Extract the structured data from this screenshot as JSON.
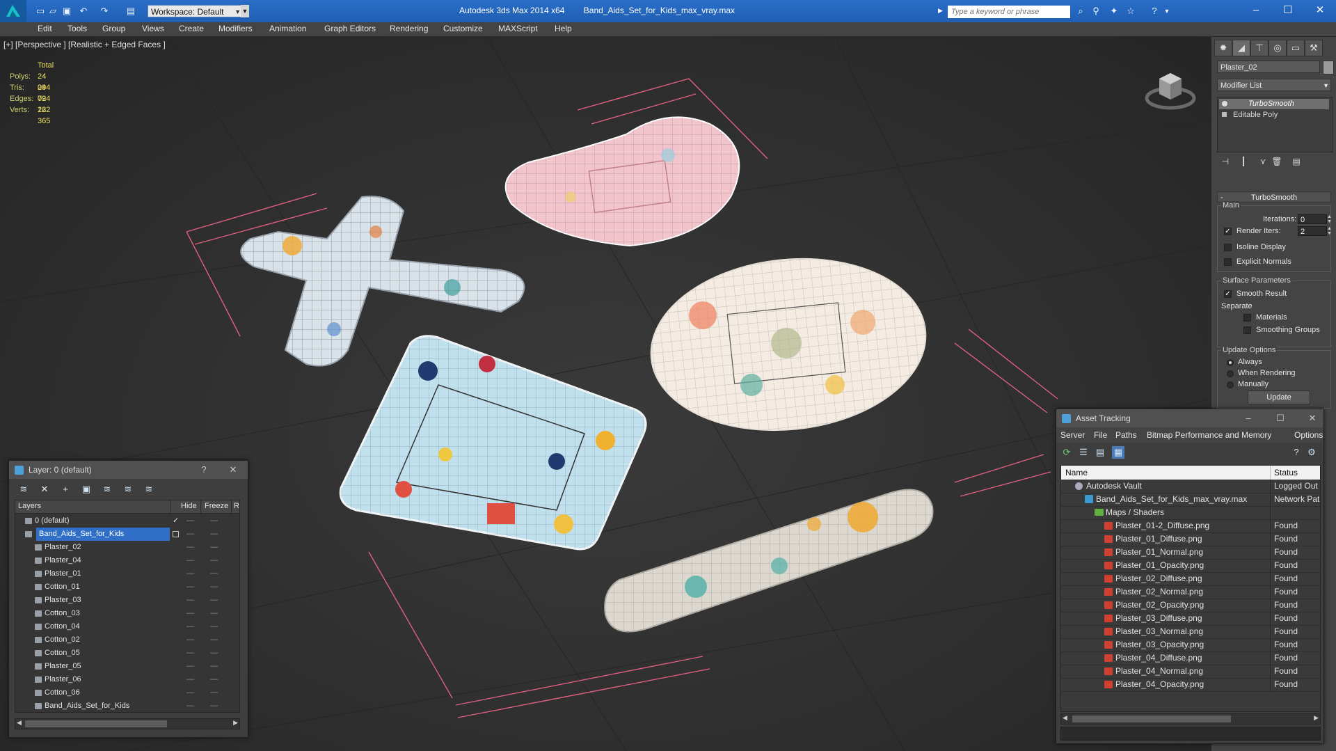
{
  "titlebar": {
    "workspace": "Workspace: Default",
    "app_name": "Autodesk 3ds Max  2014 x64",
    "file_name": "Band_Aids_Set_for_Kids_max_vray.max",
    "search_placeholder": "Type a keyword or phrase"
  },
  "menu": [
    "Edit",
    "Tools",
    "Group",
    "Views",
    "Create",
    "Modifiers",
    "Animation",
    "Graph Editors",
    "Rendering",
    "Customize",
    "MAXScript",
    "Help"
  ],
  "viewport": {
    "label": "[+] [Perspective ] [Realistic + Edged Faces ]",
    "stats": {
      "header": "Total",
      "rows": [
        {
          "key": "Polys:",
          "value": "24 094"
        },
        {
          "key": "Tris:",
          "value": "24 094"
        },
        {
          "key": "Edges:",
          "value": "72 282"
        },
        {
          "key": "Verts:",
          "value": "12 365"
        }
      ]
    }
  },
  "command_panel": {
    "object_name": "Plaster_02",
    "modifier_list": "Modifier List",
    "stack": [
      "TurboSmooth",
      "Editable Poly"
    ],
    "rollout_title": "TurboSmooth",
    "main_group": "Main",
    "iterations_label": "Iterations:",
    "iterations_value": "0",
    "render_iters_label": "Render Iters:",
    "render_iters_value": "2",
    "isoline_display": "Isoline Display",
    "explicit_normals": "Explicit Normals",
    "surface_group": "Surface Parameters",
    "smooth_result": "Smooth Result",
    "separate_label": "Separate",
    "materials": "Materials",
    "smoothing_groups": "Smoothing Groups",
    "update_group": "Update Options",
    "opt_always": "Always",
    "opt_when_rendering": "When Rendering",
    "opt_manually": "Manually",
    "update_button": "Update"
  },
  "layer_dialog": {
    "title": "Layer: 0 (default)",
    "help": "?",
    "columns": [
      "Layers",
      "Hide",
      "Freeze",
      "R"
    ],
    "rows": [
      {
        "name": "0 (default)",
        "level": 0,
        "check": "✓"
      },
      {
        "name": "Band_Aids_Set_for_Kids",
        "level": 0,
        "selected": true
      },
      {
        "name": "Plaster_02",
        "level": 1
      },
      {
        "name": "Plaster_04",
        "level": 1
      },
      {
        "name": "Plaster_01",
        "level": 1
      },
      {
        "name": "Cotton_01",
        "level": 1
      },
      {
        "name": "Plaster_03",
        "level": 1
      },
      {
        "name": "Cotton_03",
        "level": 1
      },
      {
        "name": "Cotton_04",
        "level": 1
      },
      {
        "name": "Cotton_02",
        "level": 1
      },
      {
        "name": "Cotton_05",
        "level": 1
      },
      {
        "name": "Plaster_05",
        "level": 1
      },
      {
        "name": "Plaster_06",
        "level": 1
      },
      {
        "name": "Cotton_06",
        "level": 1
      },
      {
        "name": "Band_Aids_Set_for_Kids",
        "level": 1
      }
    ]
  },
  "asset_dialog": {
    "title": "Asset Tracking",
    "menu": [
      "Server",
      "File",
      "Paths",
      "Bitmap Performance and Memory",
      "Options"
    ],
    "columns": [
      "Name",
      "Status"
    ],
    "rows": [
      {
        "name": "Autodesk Vault",
        "status": "Logged Out",
        "level": 1,
        "icon": "vault"
      },
      {
        "name": "Band_Aids_Set_for_Kids_max_vray.max",
        "status": "Network Pat",
        "level": 2,
        "icon": "max"
      },
      {
        "name": "Maps / Shaders",
        "status": "",
        "level": 3,
        "icon": "folder"
      },
      {
        "name": "Plaster_01-2_Diffuse.png",
        "status": "Found",
        "level": 4,
        "icon": "png"
      },
      {
        "name": "Plaster_01_Diffuse.png",
        "status": "Found",
        "level": 4,
        "icon": "png"
      },
      {
        "name": "Plaster_01_Normal.png",
        "status": "Found",
        "level": 4,
        "icon": "png"
      },
      {
        "name": "Plaster_01_Opacity.png",
        "status": "Found",
        "level": 4,
        "icon": "png"
      },
      {
        "name": "Plaster_02_Diffuse.png",
        "status": "Found",
        "level": 4,
        "icon": "png"
      },
      {
        "name": "Plaster_02_Normal.png",
        "status": "Found",
        "level": 4,
        "icon": "png"
      },
      {
        "name": "Plaster_02_Opacity.png",
        "status": "Found",
        "level": 4,
        "icon": "png"
      },
      {
        "name": "Plaster_03_Diffuse.png",
        "status": "Found",
        "level": 4,
        "icon": "png"
      },
      {
        "name": "Plaster_03_Normal.png",
        "status": "Found",
        "level": 4,
        "icon": "png"
      },
      {
        "name": "Plaster_03_Opacity.png",
        "status": "Found",
        "level": 4,
        "icon": "png"
      },
      {
        "name": "Plaster_04_Diffuse.png",
        "status": "Found",
        "level": 4,
        "icon": "png"
      },
      {
        "name": "Plaster_04_Normal.png",
        "status": "Found",
        "level": 4,
        "icon": "png"
      },
      {
        "name": "Plaster_04_Opacity.png",
        "status": "Found",
        "level": 4,
        "icon": "png"
      }
    ]
  },
  "colors": {
    "titlebar": "#1f5fb4",
    "selection": "#2f6fc8",
    "stats_text": "#f0e060",
    "bbox_lines": "#e06080",
    "heart": "#f2c4cc",
    "circle": "#f4ece2",
    "square": "#bfe0ec",
    "strip": "#dcd8d0"
  }
}
